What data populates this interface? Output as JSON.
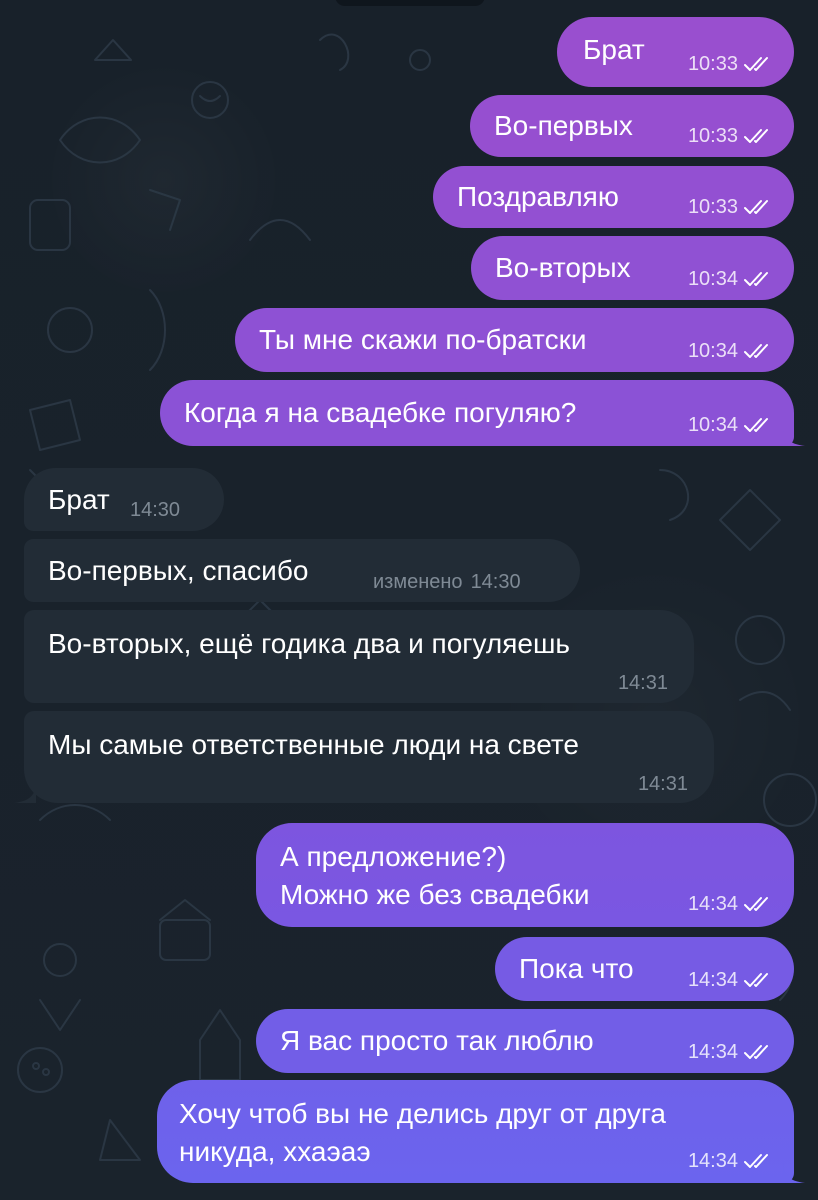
{
  "chat": {
    "colors": {
      "background": "#1a232c",
      "incoming_bubble": "#222c36",
      "outgoing_top": "#9a4fcf",
      "outgoing_bottom": "#6a66f0"
    },
    "messages": [
      {
        "direction": "out",
        "text": "Брат",
        "time": "10:33",
        "read": true
      },
      {
        "direction": "out",
        "text": "Во-первых",
        "time": "10:33",
        "read": true
      },
      {
        "direction": "out",
        "text": "Поздравляю",
        "time": "10:33",
        "read": true
      },
      {
        "direction": "out",
        "text": "Во-вторых",
        "time": "10:34",
        "read": true
      },
      {
        "direction": "out",
        "text": "Ты мне скажи по-братски",
        "time": "10:34",
        "read": true
      },
      {
        "direction": "out",
        "text": "Когда я на свадебке погуляю?",
        "time": "10:34",
        "read": true
      },
      {
        "direction": "in",
        "text": "Брат",
        "time": "14:30"
      },
      {
        "direction": "in",
        "text": "Во-первых, спасибо",
        "edited": "изменено",
        "time": "14:30"
      },
      {
        "direction": "in",
        "text": "Во-вторых, ещё годика два и погуляешь",
        "time": "14:31"
      },
      {
        "direction": "in",
        "text": "Мы самые ответственные люди на свете",
        "time": "14:31"
      },
      {
        "direction": "out",
        "lines": [
          "А предложение?)",
          "Можно же без свадебки"
        ],
        "time": "14:34",
        "read": true
      },
      {
        "direction": "out",
        "text": "Пока что",
        "time": "14:34",
        "read": true
      },
      {
        "direction": "out",
        "text": "Я вас просто так люблю",
        "time": "14:34",
        "read": true
      },
      {
        "direction": "out",
        "lines": [
          "Хочу чтоб вы не делись друг от друга",
          "никуда, ххаэаэ"
        ],
        "time": "14:34",
        "read": true
      }
    ]
  }
}
